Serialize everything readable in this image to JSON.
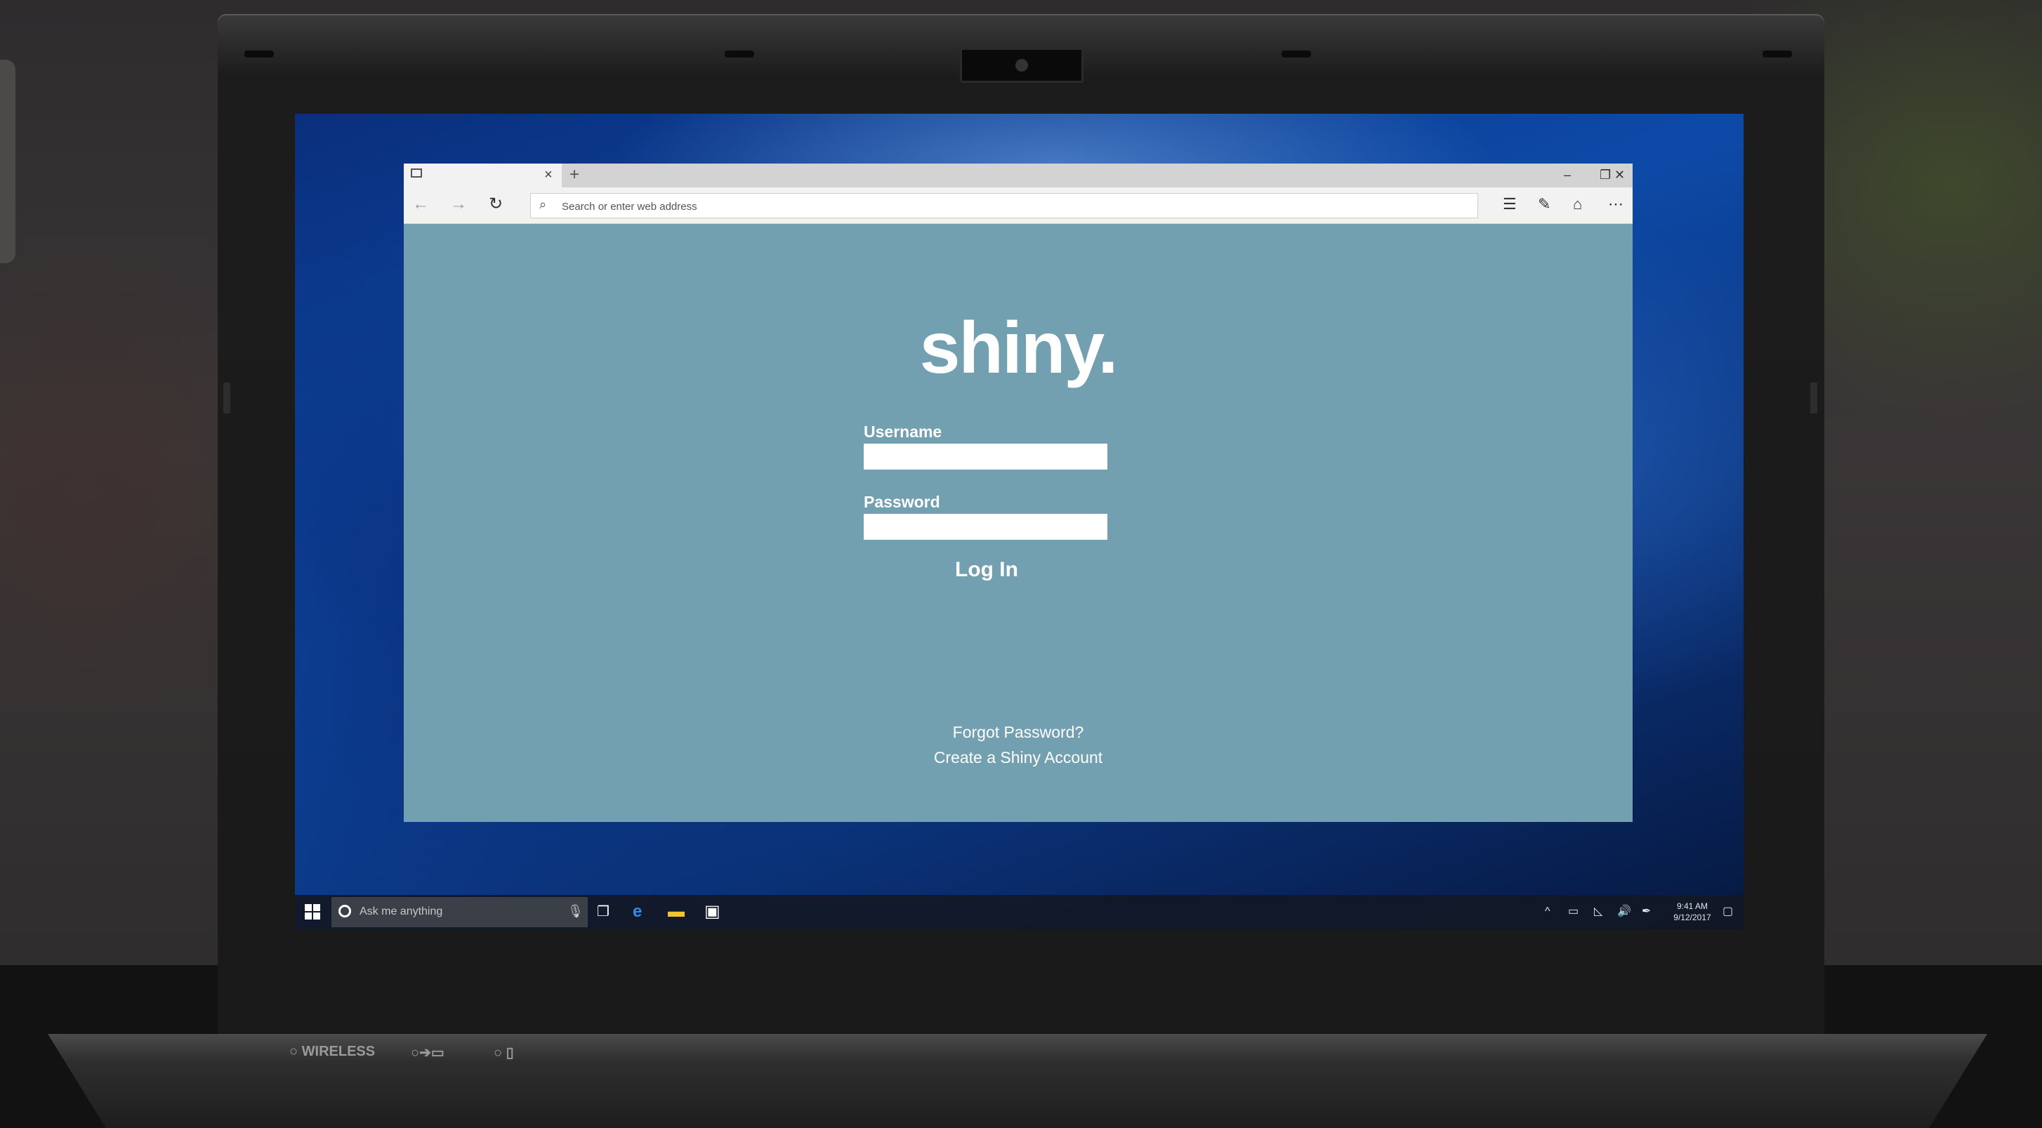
{
  "browser": {
    "tab_close_glyph": "×",
    "new_tab_glyph": "+",
    "window_controls": {
      "minimize": "–",
      "restore": "❐",
      "close": "✕"
    },
    "nav": {
      "back": "←",
      "forward": "→",
      "refresh": "↻"
    },
    "address_bar": {
      "placeholder": "Search or enter web address",
      "value": "",
      "icon": "search-icon"
    },
    "tools": {
      "hub": "☰",
      "notes": "✎",
      "share": "⌂",
      "more": "⋯"
    }
  },
  "page": {
    "logo": "shiny.",
    "username_label": "Username",
    "password_label": "Password",
    "login_label": "Log In",
    "forgot_password": "Forgot Password?",
    "create_account": "Create a Shiny Account",
    "background_color": "#73a0b0"
  },
  "taskbar": {
    "cortana_placeholder": "Ask me anything",
    "mic_glyph": "🎙",
    "task_view_glyph": "❐",
    "edge_glyph": "e",
    "explorer_glyph": "▬",
    "store_glyph": "▣",
    "tray": {
      "chevron": "^",
      "battery": "▭",
      "network": "◺",
      "volume": "🔊",
      "pen": "✒",
      "notifications": "▢"
    },
    "time": "9:41 AM",
    "date": "9/12/2017"
  },
  "laptop": {
    "wireless_label": "WIRELESS"
  }
}
